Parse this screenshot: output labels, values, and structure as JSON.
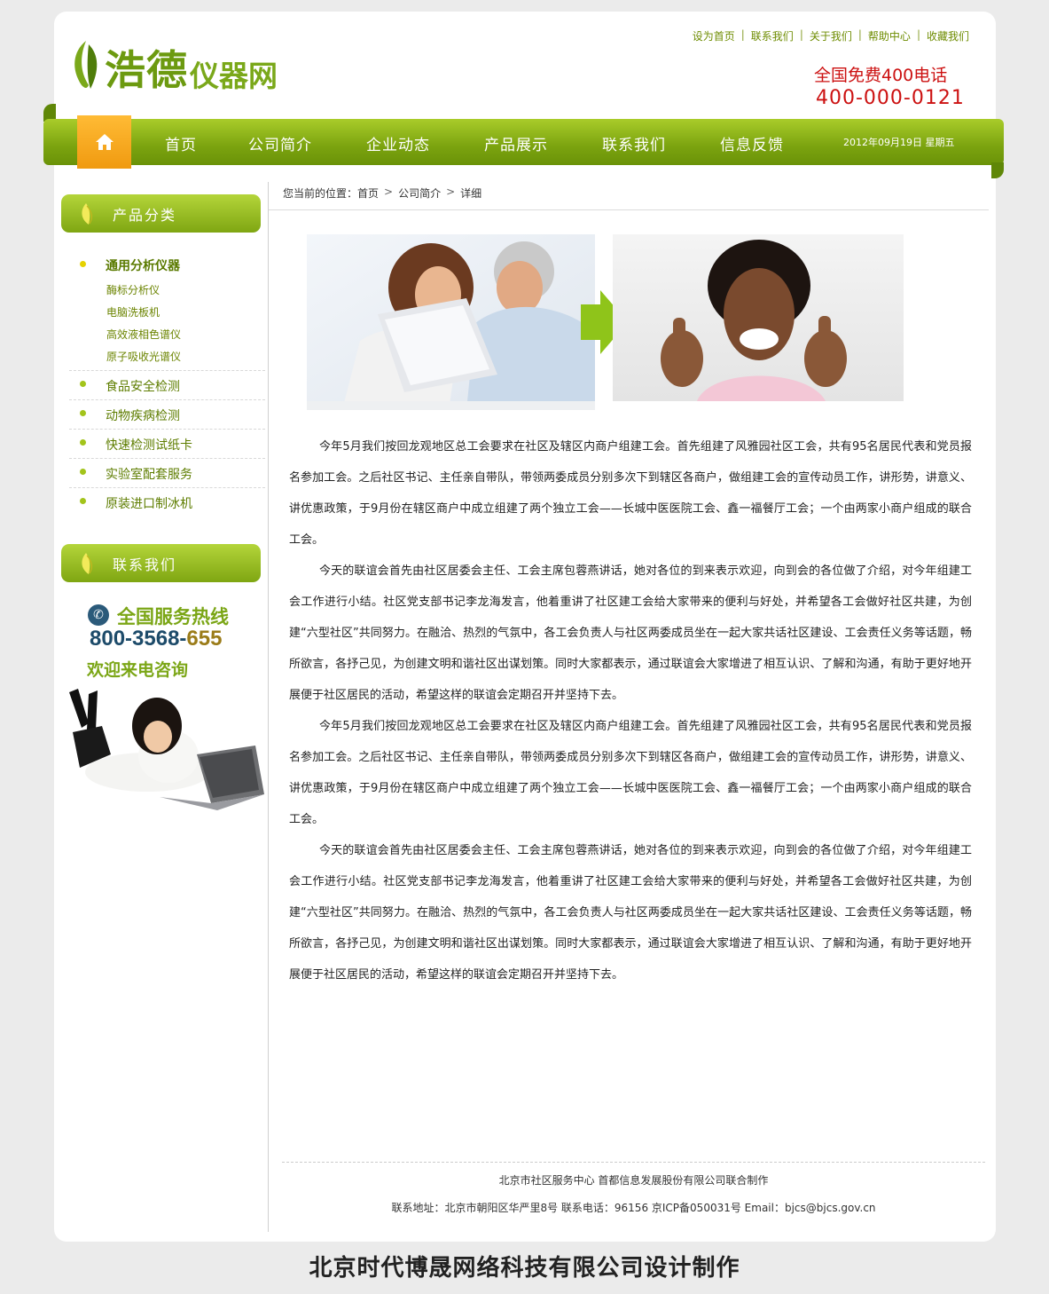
{
  "header": {
    "logo_main": "浩德",
    "logo_sub": "仪器网",
    "top_links": [
      "设为首页",
      "联系我们",
      "关于我们",
      "帮助中心",
      "收藏我们"
    ],
    "hotline_title": "全国免费400电话",
    "hotline_number": "400-000-0121"
  },
  "nav": {
    "items": [
      "首页",
      "公司简介",
      "企业动态",
      "产品展示",
      "联系我们",
      "信息反馈"
    ],
    "date": "2012年09月19日  星期五"
  },
  "sidebar": {
    "category_title": "产品分类",
    "main_category": "通用分析仪器",
    "sub_items": [
      "酶标分析仪",
      "电脑洗板机",
      "高效液相色谱仪",
      "原子吸收光谱仪"
    ],
    "categories": [
      "食品安全检测",
      "动物疾病检测",
      "快速检测试纸卡",
      "实验室配套服务",
      "原装进口制冰机"
    ],
    "contact_title": "联系我们",
    "service_title": "全国服务热线",
    "service_number_a": "800-3568-",
    "service_number_b": "655",
    "service_welcome": "欢迎来电咨询"
  },
  "breadcrumb": {
    "prefix": "您当前的位置：",
    "items": [
      "首页",
      "公司简介",
      "详细"
    ]
  },
  "article": {
    "paragraphs": [
      "今年5月我们按回龙观地区总工会要求在社区及辖区内商户组建工会。首先组建了风雅园社区工会，共有95名居民代表和党员报名参加工会。之后社区书记、主任亲自带队，带领两委成员分别多次下到辖区各商户，做组建工会的宣传动员工作，讲形势，讲意义、讲优惠政策，于9月份在辖区商户中成立组建了两个独立工会——长城中医医院工会、鑫一福餐厅工会；一个由两家小商户组成的联合工会。",
      "今天的联谊会首先由社区居委会主任、工会主席包蓉燕讲话，她对各位的到来表示欢迎，向到会的各位做了介绍，对今年组建工会工作进行小结。社区党支部书记李龙海发言，他着重讲了社区建工会给大家带来的便利与好处，并希望各工会做好社区共建，为创建“六型社区”共同努力。在融洽、热烈的气氛中，各工会负责人与社区两委成员坐在一起大家共话社区建设、工会责任义务等话题，畅所欲言，各抒己见，为创建文明和谐社区出谋划策。同时大家都表示，通过联谊会大家增进了相互认识、了解和沟通，有助于更好地开展便于社区居民的活动，希望这样的联谊会定期召开并坚持下去。",
      "今年5月我们按回龙观地区总工会要求在社区及辖区内商户组建工会。首先组建了风雅园社区工会，共有95名居民代表和党员报名参加工会。之后社区书记、主任亲自带队，带领两委成员分别多次下到辖区各商户，做组建工会的宣传动员工作，讲形势，讲意义、讲优惠政策，于9月份在辖区商户中成立组建了两个独立工会——长城中医医院工会、鑫一福餐厅工会；一个由两家小商户组成的联合工会。",
      "今天的联谊会首先由社区居委会主任、工会主席包蓉燕讲话，她对各位的到来表示欢迎，向到会的各位做了介绍，对今年组建工会工作进行小结。社区党支部书记李龙海发言，他着重讲了社区建工会给大家带来的便利与好处，并希望各工会做好社区共建，为创建“六型社区”共同努力。在融洽、热烈的气氛中，各工会负责人与社区两委成员坐在一起大家共话社区建设、工会责任义务等话题，畅所欲言，各抒己见，为创建文明和谐社区出谋划策。同时大家都表示，通过联谊会大家增进了相互认识、了解和沟通，有助于更好地开展便于社区居民的活动，希望这样的联谊会定期召开并坚持下去。"
    ]
  },
  "footer": {
    "line1": "北京市社区服务中心 首都信息发展股份有限公司联合制作",
    "line2": "联系地址：北京市朝阳区华严里8号 联系电话：96156 京ICP备050031号 Email：bjcs@bjcs.gov.cn"
  },
  "credit": "北京时代博晟网络科技有限公司设计制作",
  "colors": {
    "brand_green": "#7ba30f",
    "home_orange": "#f09a10",
    "hotline_red": "#cc1111"
  }
}
